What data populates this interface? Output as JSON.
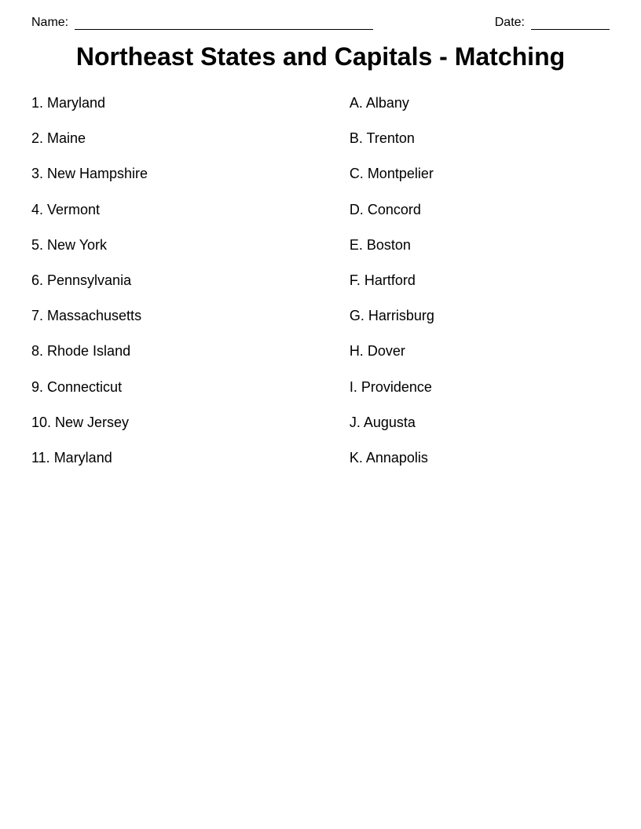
{
  "header": {
    "name_label": "Name:",
    "date_label": "Date:"
  },
  "title": "Northeast States and Capitals - Matching",
  "states": [
    {
      "number": "1.",
      "name": "Maryland"
    },
    {
      "number": "2.",
      "name": "Maine"
    },
    {
      "number": "3.",
      "name": "New Hampshire"
    },
    {
      "number": "4.",
      "name": "Vermont"
    },
    {
      "number": "5.",
      "name": "New York"
    },
    {
      "number": "6.",
      "name": "Pennsylvania"
    },
    {
      "number": "7.",
      "name": "Massachusetts"
    },
    {
      "number": "8.",
      "name": "Rhode Island"
    },
    {
      "number": "9.",
      "name": "Connecticut"
    },
    {
      "number": "10.",
      "name": "New Jersey"
    },
    {
      "number": "11.",
      "name": "Maryland"
    }
  ],
  "capitals": [
    {
      "letter": "A.",
      "city": "Albany"
    },
    {
      "letter": "B.",
      "city": "Trenton"
    },
    {
      "letter": "C.",
      "city": "Montpelier"
    },
    {
      "letter": "D.",
      "city": "Concord"
    },
    {
      "letter": "E.",
      "city": "Boston"
    },
    {
      "letter": "F.",
      "city": "Hartford"
    },
    {
      "letter": "G.",
      "city": "Harrisburg"
    },
    {
      "letter": "H.",
      "city": "Dover"
    },
    {
      "letter": "I.",
      "city": "Providence"
    },
    {
      "letter": "J.",
      "city": "Augusta"
    },
    {
      "letter": "K.",
      "city": "Annapolis"
    }
  ]
}
